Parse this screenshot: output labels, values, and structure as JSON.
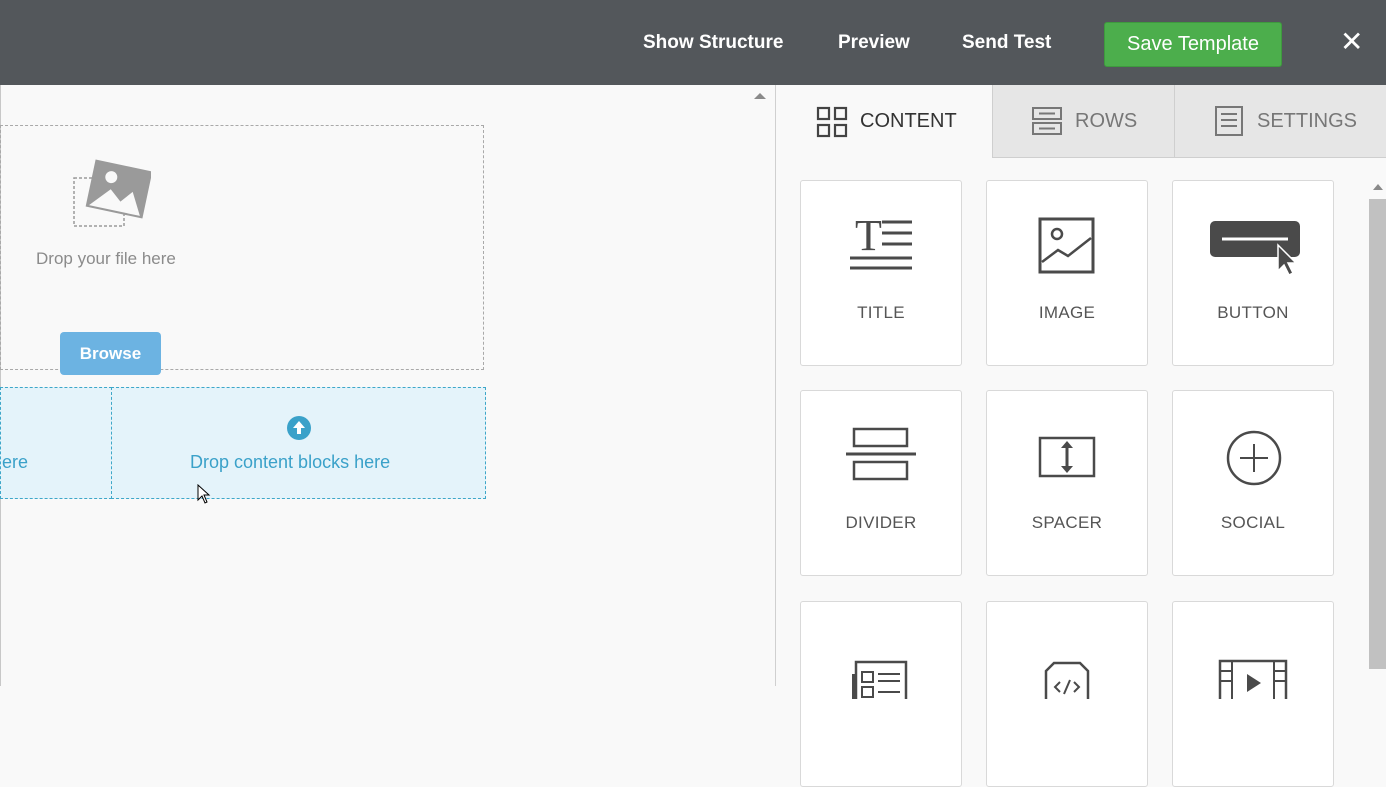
{
  "header": {
    "show_structure": "Show Structure",
    "preview": "Preview",
    "send_test": "Send Test",
    "save_template": "Save Template",
    "close": "✕"
  },
  "canvas": {
    "image_block": {
      "drop_text": "Drop your file here",
      "browse_label": "Browse"
    },
    "content_drop_left_text": "ere",
    "content_drop_right_text": "Drop content blocks here"
  },
  "panel": {
    "tabs": [
      {
        "label": "CONTENT",
        "icon": "grid-icon",
        "active": true
      },
      {
        "label": "ROWS",
        "icon": "rows-icon",
        "active": false
      },
      {
        "label": "SETTINGS",
        "icon": "settings-doc-icon",
        "active": false
      }
    ],
    "tiles": [
      {
        "label": "TITLE",
        "icon": "title-icon"
      },
      {
        "label": "IMAGE",
        "icon": "image-icon"
      },
      {
        "label": "BUTTON",
        "icon": "button-icon"
      },
      {
        "label": "DIVIDER",
        "icon": "divider-icon"
      },
      {
        "label": "SPACER",
        "icon": "spacer-icon"
      },
      {
        "label": "SOCIAL",
        "icon": "social-icon"
      },
      {
        "label": "",
        "icon": "text-list-icon"
      },
      {
        "label": "",
        "icon": "html-code-icon"
      },
      {
        "label": "",
        "icon": "video-icon"
      }
    ]
  },
  "colors": {
    "topbar": "#53575b",
    "save_button": "#4cae4c",
    "browse_button": "#6cb3e2",
    "drop_zone_bg": "#e4f3fa",
    "drop_zone_accent": "#3aa1c9"
  }
}
